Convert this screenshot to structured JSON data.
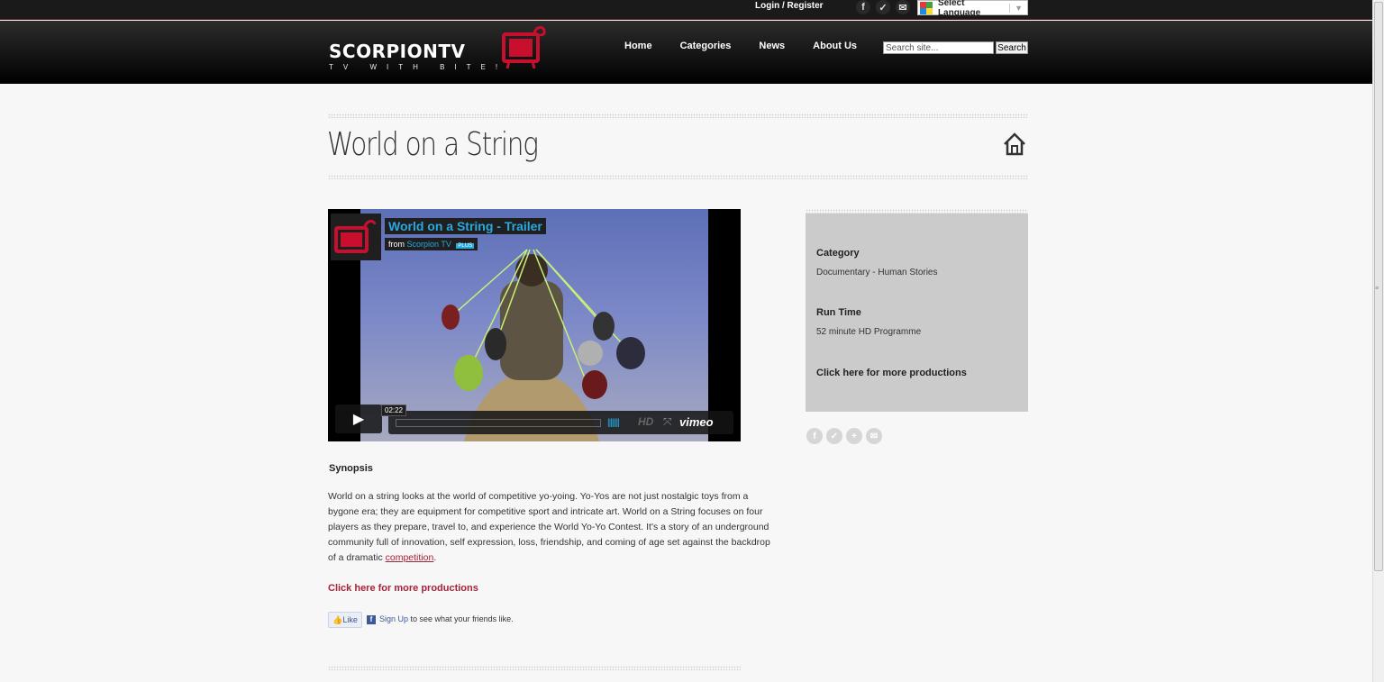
{
  "topbar": {
    "login_label": "Login / Register",
    "social_icons": [
      "facebook-icon",
      "twitter-icon",
      "mail-icon"
    ],
    "language_label": "Select Language"
  },
  "header": {
    "logo_text": "SCORPION",
    "logo_text_tv": "TV",
    "logo_tagline": "TV WITH BITE!",
    "nav": [
      "Home",
      "Categories",
      "News",
      "About Us"
    ],
    "search": {
      "placeholder": "Search site...",
      "value": "Search site...",
      "button": "Search"
    }
  },
  "page": {
    "title": "World on a String"
  },
  "video": {
    "title": "World on a String - Trailer",
    "from_label": "from",
    "channel": "Scorpion TV",
    "badge": "PLUS",
    "duration": "02:22",
    "hd_label": "HD",
    "brand": "vimeo"
  },
  "synopsis": {
    "heading": "Synopsis",
    "text": "World on a string looks at the world of competitive yo-yoing. Yo-Yos are not just nostalgic toys from a bygone era; they are equipment for competitive sport and intricate art. World on a String focuses on four players as they prepare, travel to, and experience the World Yo-Yo Contest. It's a story of an underground community full of innovation, self expression, loss, friendship, and coming of age set against the backdrop of a dramatic ",
    "link_text": "competition",
    "end": ".",
    "more_link": "Click here for more productions"
  },
  "facebook": {
    "like_label": "Like",
    "signup_link": "Sign Up",
    "signup_text": " to see what your friends like."
  },
  "sidebar": {
    "category_label": "Category",
    "category_value": "Documentary - Human Stories",
    "runtime_label": "Run Time",
    "runtime_value": "52 minute HD Programme",
    "more_link": "Click here for more productions",
    "share_icons": [
      "facebook-icon",
      "twitter-icon",
      "plus-icon",
      "mail-icon"
    ]
  },
  "colors": {
    "accent": "#a3233a",
    "header_bg": "#000000",
    "sidebar_bg": "#cbcbcb",
    "vimeo_blue": "#28a9e0"
  }
}
